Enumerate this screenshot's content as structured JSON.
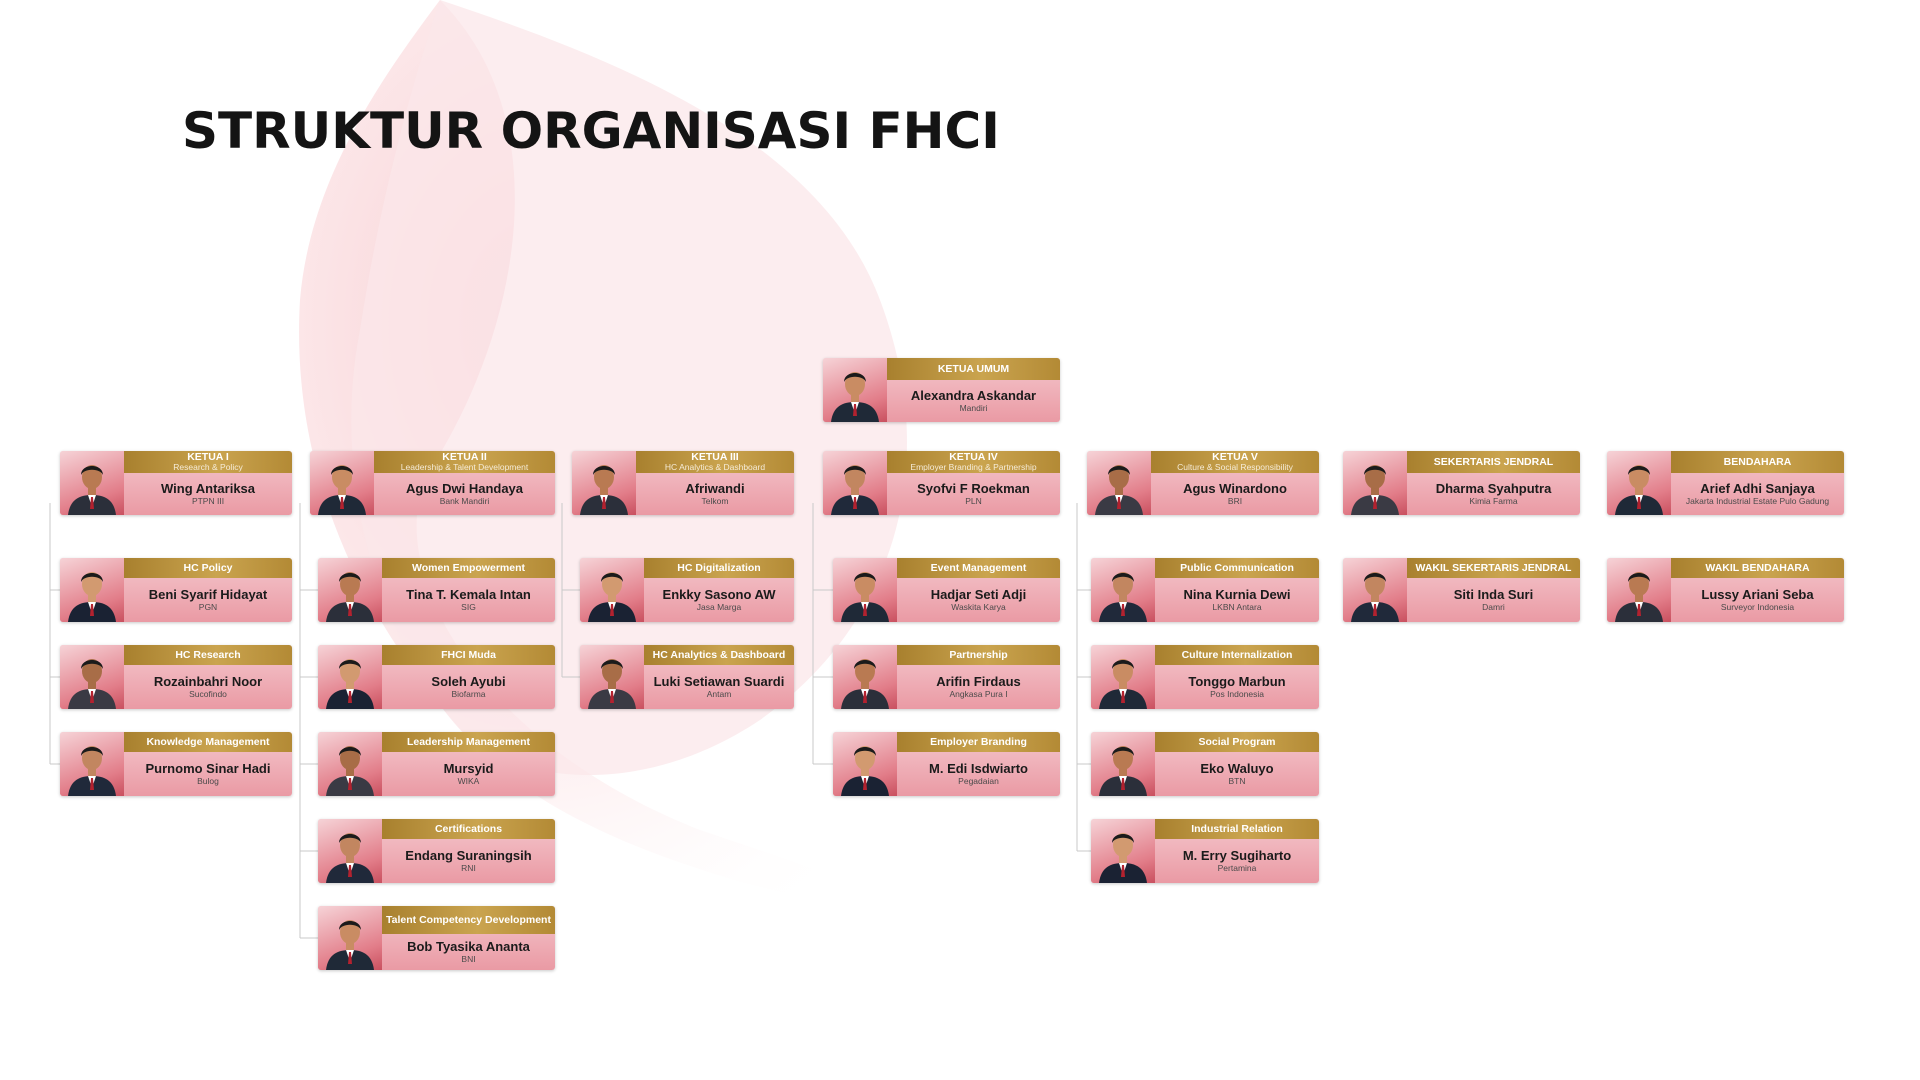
{
  "title": "STRUKTUR ORGANISASI FHCI",
  "colors": {
    "gold": "#b8913d",
    "pink": "#ef9fa9",
    "title": "#141414",
    "connector": "#c9c9c9"
  },
  "top": {
    "role": "KETUA UMUM",
    "name": "Alexandra Askandar",
    "org": "Mandiri"
  },
  "columns": [
    {
      "head": {
        "role": "KETUA I",
        "sub": "Research & Policy",
        "name": "Wing Antariksa",
        "org": "PTPN III"
      },
      "members": [
        {
          "role": "HC Policy",
          "name": "Beni Syarif Hidayat",
          "org": "PGN"
        },
        {
          "role": "HC Research",
          "name": "Rozainbahri Noor",
          "org": "Sucofindo"
        },
        {
          "role": "Knowledge Management",
          "name": "Purnomo Sinar Hadi",
          "org": "Bulog"
        }
      ]
    },
    {
      "head": {
        "role": "KETUA II",
        "sub": "Leadership & Talent Development",
        "name": "Agus Dwi Handaya",
        "org": "Bank Mandiri"
      },
      "members": [
        {
          "role": "Women Empowerment",
          "name": "Tina T. Kemala Intan",
          "org": "SIG"
        },
        {
          "role": "FHCI Muda",
          "name": "Soleh Ayubi",
          "org": "Biofarma"
        },
        {
          "role": "Leadership Management",
          "name": "Mursyid",
          "org": "WIKA"
        },
        {
          "role": "Certifications",
          "name": "Endang Suraningsih",
          "org": "RNI"
        },
        {
          "role": "Talent Competency Development",
          "name": "Bob Tyasika Ananta",
          "org": "BNI"
        }
      ]
    },
    {
      "head": {
        "role": "KETUA III",
        "sub": "HC Analytics & Dashboard",
        "name": "Afriwandi",
        "org": "Telkom"
      },
      "members": [
        {
          "role": "HC Digitalization",
          "name": "Enkky Sasono AW",
          "org": "Jasa Marga"
        },
        {
          "role": "HC Analytics & Dashboard",
          "name": "Luki Setiawan Suardi",
          "org": "Antam"
        }
      ]
    },
    {
      "head": {
        "role": "KETUA IV",
        "sub": "Employer Branding & Partnership",
        "name": "Syofvi F Roekman",
        "org": "PLN"
      },
      "members": [
        {
          "role": "Event Management",
          "name": "Hadjar Seti Adji",
          "org": "Waskita Karya"
        },
        {
          "role": "Partnership",
          "name": "Arifin Firdaus",
          "org": "Angkasa Pura I"
        },
        {
          "role": "Employer Branding",
          "name": "M. Edi Isdwiarto",
          "org": "Pegadaian"
        }
      ]
    },
    {
      "head": {
        "role": "KETUA V",
        "sub": "Culture & Social Responsibility",
        "name": "Agus Winardono",
        "org": "BRI"
      },
      "members": [
        {
          "role": "Public Communication",
          "name": "Nina Kurnia Dewi",
          "org": "LKBN Antara"
        },
        {
          "role": "Culture Internalization",
          "name": "Tonggo Marbun",
          "org": "Pos Indonesia"
        },
        {
          "role": "Social Program",
          "name": "Eko Waluyo",
          "org": "BTN"
        },
        {
          "role": "Industrial Relation",
          "name": "M. Erry Sugiharto",
          "org": "Pertamina"
        }
      ]
    },
    {
      "head": {
        "role": "SEKERTARIS JENDRAL",
        "name": "Dharma Syahputra",
        "org": "Kimia Farma"
      },
      "members": [
        {
          "role": "WAKIL SEKERTARIS JENDRAL",
          "name": "Siti Inda Suri",
          "org": "Damri"
        }
      ]
    },
    {
      "head": {
        "role": "BENDAHARA",
        "name": "Arief Adhi Sanjaya",
        "org": "Jakarta Industrial Estate Pulo Gadung"
      },
      "members": [
        {
          "role": "WAKIL BENDAHARA",
          "name": "Lussy Ariani Seba",
          "org": "Surveyor Indonesia"
        }
      ]
    }
  ]
}
